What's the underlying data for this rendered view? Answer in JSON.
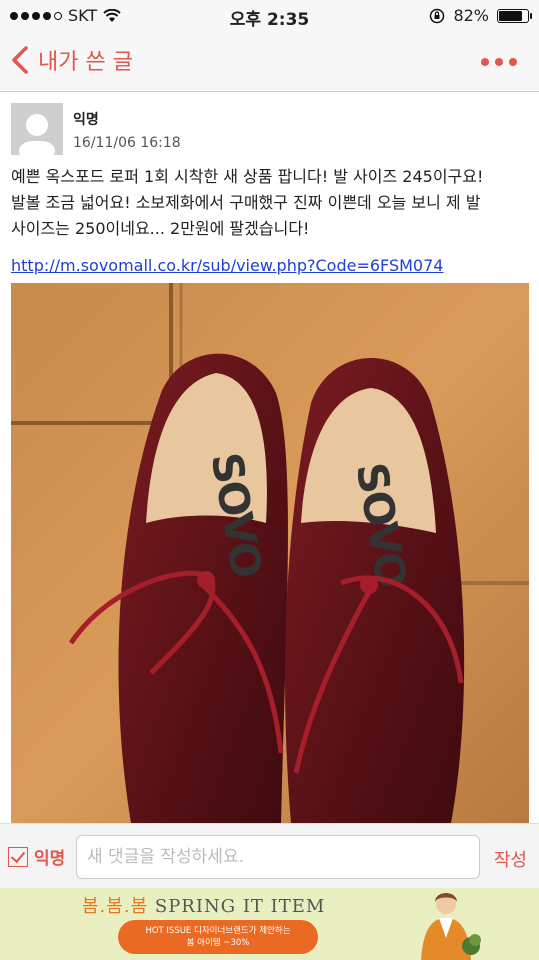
{
  "status": {
    "carrier": "SKT",
    "time": "오후 2:35",
    "battery": "82%",
    "battery_level": 0.82
  },
  "nav": {
    "back_label": "내가 쓴 글"
  },
  "post": {
    "author": "익명",
    "date": "16/11/06 16:18",
    "body_lines": [
      "예쁜 옥스포드 로퍼 1회 시착한 새 상품 팝니다! 발 사이즈 245이구요!",
      "발볼 조금 넓어요! 소보제화에서 구매했구 진짜 이쁜데 오늘 보니 제 발",
      "사이즈는 250이네요... 2만원에 팔겠습니다!"
    ],
    "link": "http://m.sovomall.co.kr/sub/view.php?Code=6FSM074",
    "photo_brand": "SOVO"
  },
  "comment": {
    "anon_label": "익명",
    "placeholder": "새 댓글을 작성하세요.",
    "value": "",
    "submit_label": "작성"
  },
  "ad": {
    "title_highlight": "봄.봄.봄",
    "title_rest": "SPRING IT ITEM",
    "pill_line1": "HOT ISSUE 디자이너브랜드가 제안하는",
    "pill_line2": "봄 아이템 ~30%"
  },
  "colors": {
    "accent": "#e2564b",
    "link": "#1f3fd6",
    "ad_background": "#e9efc0",
    "ad_pill": "#ea6a24"
  }
}
